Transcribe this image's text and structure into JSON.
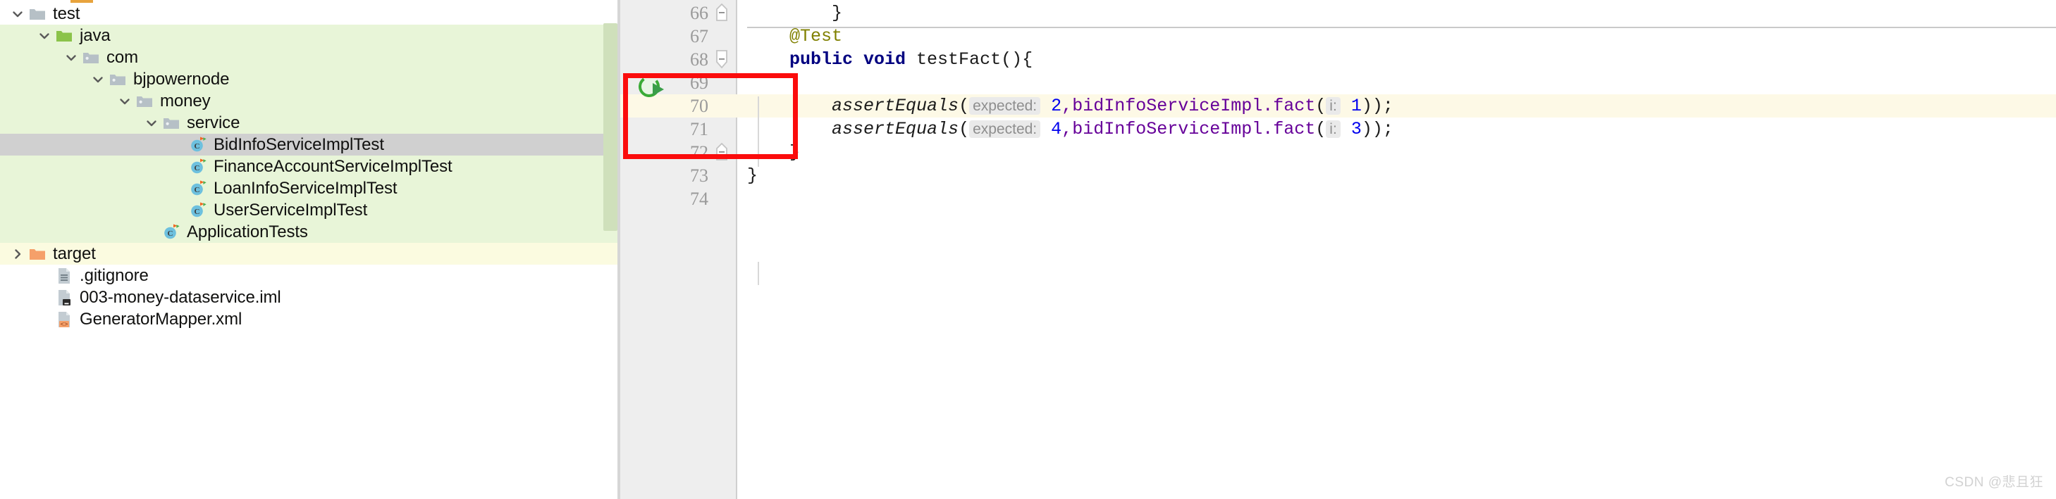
{
  "sidebar": {
    "name": "project-tree",
    "scrollbar": "vertical-scrollbar",
    "rows": [
      {
        "label": "test",
        "indent": 1,
        "arrow": "chevron-down",
        "icon": "folder-grey",
        "selected": false,
        "bg": "white"
      },
      {
        "label": "java",
        "indent": 2,
        "arrow": "chevron-down",
        "icon": "folder-green",
        "selected": false,
        "bg": "green"
      },
      {
        "label": "com",
        "indent": 3,
        "arrow": "chevron-down",
        "icon": "folder-package",
        "selected": false,
        "bg": "green"
      },
      {
        "label": "bjpowernode",
        "indent": 4,
        "arrow": "chevron-down",
        "icon": "folder-package",
        "selected": false,
        "bg": "green"
      },
      {
        "label": "money",
        "indent": 5,
        "arrow": "chevron-down",
        "icon": "folder-package",
        "selected": false,
        "bg": "green"
      },
      {
        "label": "service",
        "indent": 6,
        "arrow": "chevron-down",
        "icon": "folder-package",
        "selected": false,
        "bg": "green"
      },
      {
        "label": "BidInfoServiceImplTest",
        "indent": 7,
        "arrow": "none",
        "icon": "java-test-class",
        "selected": true,
        "bg": "selected"
      },
      {
        "label": "FinanceAccountServiceImplTest",
        "indent": 7,
        "arrow": "none",
        "icon": "java-test-class",
        "selected": false,
        "bg": "green"
      },
      {
        "label": "LoanInfoServiceImplTest",
        "indent": 7,
        "arrow": "none",
        "icon": "java-test-class",
        "selected": false,
        "bg": "green"
      },
      {
        "label": "UserServiceImplTest",
        "indent": 7,
        "arrow": "none",
        "icon": "java-test-class",
        "selected": false,
        "bg": "green"
      },
      {
        "label": "ApplicationTests",
        "indent": 6,
        "arrow": "none",
        "icon": "java-test-class",
        "selected": false,
        "bg": "green"
      },
      {
        "label": "target",
        "indent": 1,
        "arrow": "chevron-right",
        "icon": "folder-orange",
        "selected": false,
        "bg": "yellow"
      },
      {
        "label": ".gitignore",
        "indent": 2,
        "arrow": "none",
        "icon": "file-text",
        "selected": false,
        "bg": "white"
      },
      {
        "label": "003-money-dataservice.iml",
        "indent": 2,
        "arrow": "none",
        "icon": "file-iml",
        "selected": false,
        "bg": "white"
      },
      {
        "label": "GeneratorMapper.xml",
        "indent": 2,
        "arrow": "none",
        "icon": "file-xml",
        "selected": false,
        "bg": "white"
      }
    ]
  },
  "editor": {
    "name": "code-editor",
    "gutter_name": "line-number-gutter",
    "run_icon": "run-test-gutter-icon",
    "annotation": "red-highlight-rectangle",
    "lines": [
      {
        "num": "66",
        "fold": "collapse-end",
        "hl": false,
        "tokens": [
          {
            "t": "        }",
            "c": "k-plain"
          }
        ]
      },
      {
        "num": "67",
        "fold": "none",
        "hl": false,
        "tokens": [
          {
            "t": "    @Test",
            "c": "k-ann"
          }
        ]
      },
      {
        "num": "68",
        "fold": "collapse-start",
        "hl": false,
        "tokens": [
          {
            "t": "    ",
            "c": "k-plain"
          },
          {
            "t": "public void",
            "c": "k-kw"
          },
          {
            "t": " testFact(){",
            "c": "k-plain"
          }
        ]
      },
      {
        "num": "69",
        "fold": "none",
        "hl": false,
        "tokens": []
      },
      {
        "num": "70",
        "fold": "none",
        "hl": true,
        "tokens": [
          {
            "t": "        ",
            "c": "k-plain"
          },
          {
            "t": "assertEquals",
            "c": "k-static"
          },
          {
            "t": "(",
            "c": "k-plain"
          },
          {
            "t": "expected:",
            "c": "hint"
          },
          {
            "t": " ",
            "c": "k-plain"
          },
          {
            "t": "2",
            "c": "k-num"
          },
          {
            "t": ",",
            "c": "k-ident"
          },
          {
            "t": "bidInfoServiceImpl",
            "c": "k-ident"
          },
          {
            "t": ".",
            "c": "k-ident"
          },
          {
            "t": "fact",
            "c": "k-ident"
          },
          {
            "t": "(",
            "c": "k-plain"
          },
          {
            "t": "i:",
            "c": "hint"
          },
          {
            "t": " ",
            "c": "k-plain"
          },
          {
            "t": "1",
            "c": "k-num"
          },
          {
            "t": "));",
            "c": "k-plain"
          }
        ]
      },
      {
        "num": "71",
        "fold": "none",
        "hl": false,
        "tokens": [
          {
            "t": "        ",
            "c": "k-plain"
          },
          {
            "t": "assertEquals",
            "c": "k-static"
          },
          {
            "t": "(",
            "c": "k-plain"
          },
          {
            "t": "expected:",
            "c": "hint"
          },
          {
            "t": " ",
            "c": "k-plain"
          },
          {
            "t": "4",
            "c": "k-num"
          },
          {
            "t": ",",
            "c": "k-ident"
          },
          {
            "t": "bidInfoServiceImpl",
            "c": "k-ident"
          },
          {
            "t": ".",
            "c": "k-ident"
          },
          {
            "t": "fact",
            "c": "k-ident"
          },
          {
            "t": "(",
            "c": "k-plain"
          },
          {
            "t": "i:",
            "c": "hint"
          },
          {
            "t": " ",
            "c": "k-plain"
          },
          {
            "t": "3",
            "c": "k-num"
          },
          {
            "t": "));",
            "c": "k-plain"
          }
        ]
      },
      {
        "num": "72",
        "fold": "collapse-end",
        "hl": false,
        "tokens": [
          {
            "t": "    }",
            "c": "k-plain"
          }
        ]
      },
      {
        "num": "73",
        "fold": "none",
        "hl": false,
        "tokens": [
          {
            "t": "}",
            "c": "k-plain"
          }
        ]
      },
      {
        "num": "74",
        "fold": "none",
        "hl": false,
        "tokens": []
      }
    ]
  },
  "watermark": {
    "text": "CSDN @悲且狂"
  },
  "colors": {
    "tree_green_bg": "#e8f5d8",
    "tree_yellow_bg": "#fbfbe0",
    "tree_selected_bg": "#d0d0d0",
    "gutter_bg": "#eeeeee",
    "current_line_bg": "#fdf9e6",
    "annotation_red": "#fb0c0c",
    "run_icon_green": "#3aab36",
    "folder_green": "#8bc34a",
    "folder_orange": "#f5a06a",
    "keyword_blue": "#000080",
    "annotation_olive": "#808000",
    "number_blue": "#0000ee",
    "identifier_purple": "#660099"
  }
}
